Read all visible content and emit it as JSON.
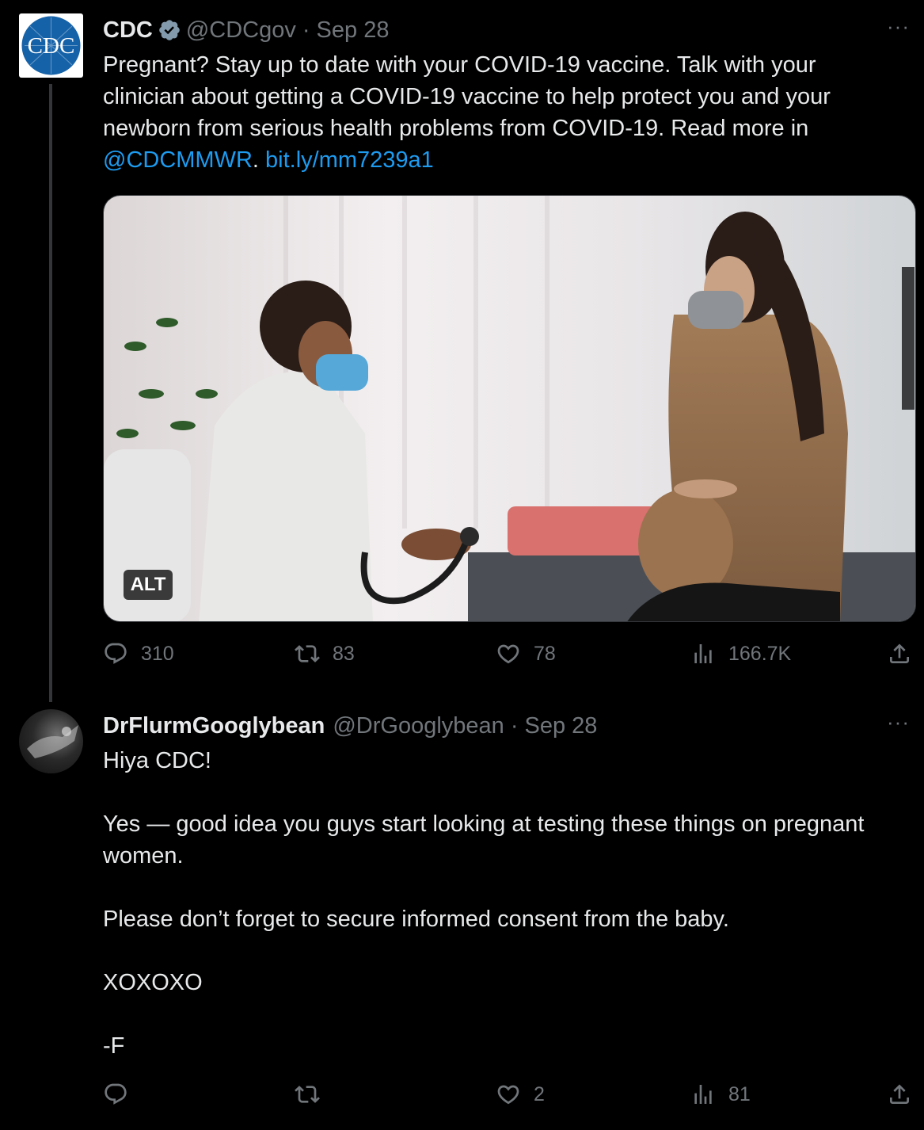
{
  "tweet1": {
    "name": "CDC",
    "handle": "@CDCgov",
    "separator": "·",
    "date": "Sep 28",
    "more": "···",
    "avatar_text": "CDC",
    "text_body": "Pregnant? Stay up to date with your COVID-19 vaccine. Talk with your clinician about getting a COVID-19 vaccine to help protect you and your newborn from serious health problems from COVID-19. Read more in ",
    "mention": "@CDCMMWR",
    "separator2": ".",
    "url": " bit.ly/mm7239a1",
    "alt_label": "ALT",
    "stats": {
      "replies": "310",
      "retweets": "83",
      "likes": "78",
      "views": "166.7K"
    }
  },
  "tweet2": {
    "name": "DrFlurmGooglybean",
    "handle": "@DrGooglybean",
    "separator": "·",
    "date": "Sep 28",
    "more": "···",
    "text": "Hiya CDC!\n\nYes — good idea you guys start looking at testing these things on pregnant women.\n\nPlease don’t forget to secure informed consent from the baby.\n\nXOXOXO\n\n-F",
    "stats": {
      "replies": "",
      "retweets": "",
      "likes": "2",
      "views": "81"
    }
  },
  "colors": {
    "background": "#000000",
    "text": "#e7e9ea",
    "muted": "#71767b",
    "link": "#1d9bf0",
    "verified": "#829aab",
    "cdc_blue": "#1662a8"
  },
  "icons": [
    "verified-badge-icon",
    "more-icon",
    "reply-icon",
    "retweet-icon",
    "like-icon",
    "views-icon",
    "share-icon"
  ]
}
